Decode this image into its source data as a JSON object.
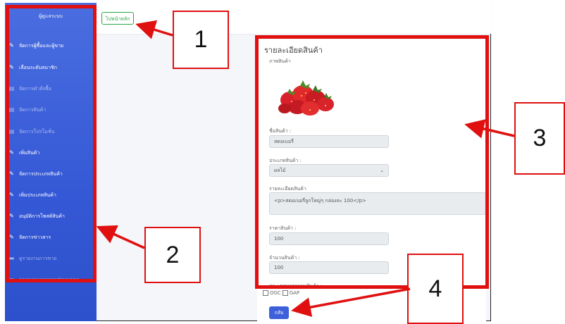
{
  "sidebar": {
    "brand": "ผู้ดูแลระบบ",
    "items": [
      {
        "label": "จัดการผู้ซื้อและผู้ขาย",
        "icon": "wrench-icon",
        "faded": false
      },
      {
        "label": "เลื่อนระดับสมาชิก",
        "icon": "wrench-icon",
        "faded": false
      },
      {
        "label": "จัดการคำสั่งซื้อ",
        "icon": "list-icon",
        "faded": true
      },
      {
        "label": "จัดการสินค้า",
        "icon": "list-icon",
        "faded": true
      },
      {
        "label": "จัดการโปรโมชั่น",
        "icon": "list-icon",
        "faded": true
      },
      {
        "label": "เพิ่มสินค้า",
        "icon": "wrench-icon",
        "faded": false
      },
      {
        "label": "จัดการประเภทสินค้า",
        "icon": "wrench-icon",
        "faded": false
      },
      {
        "label": "เพิ่มประเภทสินค้า",
        "icon": "wrench-icon",
        "faded": false
      },
      {
        "label": "อนุมัติการโพสต์สินค้า",
        "icon": "wrench-icon",
        "faded": false
      },
      {
        "label": "จัดการข่าวสาร",
        "icon": "wrench-icon",
        "faded": false
      },
      {
        "label": "ดูรายงานการขาย",
        "icon": "chart-icon",
        "faded": true
      },
      {
        "label": "ดูรายงานยอดขายส่วนบุคคล",
        "icon": "chart-icon",
        "faded": true
      }
    ]
  },
  "topbar": {
    "home_button": "ไปหน้าหลัก"
  },
  "product": {
    "title": "รายละเอียดสินค้า",
    "image_label": "ภาพสินค้า",
    "name_label": "ชื่อสินค้า :",
    "name_value": "สตอเบอรี่",
    "type_label": "ประเภทสินค้า :",
    "type_value": "ผลไม้",
    "detail_label": "รายละเอียดสินค้า",
    "detail_value": "<p>สตอเบอรี่ลูกใหญ่ๆ กล่องละ 100</p>",
    "price_label": "ราคาสินค้า :",
    "price_value": "100",
    "qty_label": "จำนวนสินค้า :",
    "qty_value": "100",
    "cert_label": "ประเภทมาตรฐานสินค้า :",
    "cert_ogc": "OGC",
    "cert_gap": "GAP",
    "back_button": "กลับ"
  },
  "annotations": {
    "label_1": "1",
    "label_2": "2",
    "label_3": "3",
    "label_4": "4",
    "color": "#e01010"
  },
  "colors": {
    "sidebar": "#3558d6",
    "home_button": "#28a745",
    "back_button": "#3d5fd9"
  }
}
